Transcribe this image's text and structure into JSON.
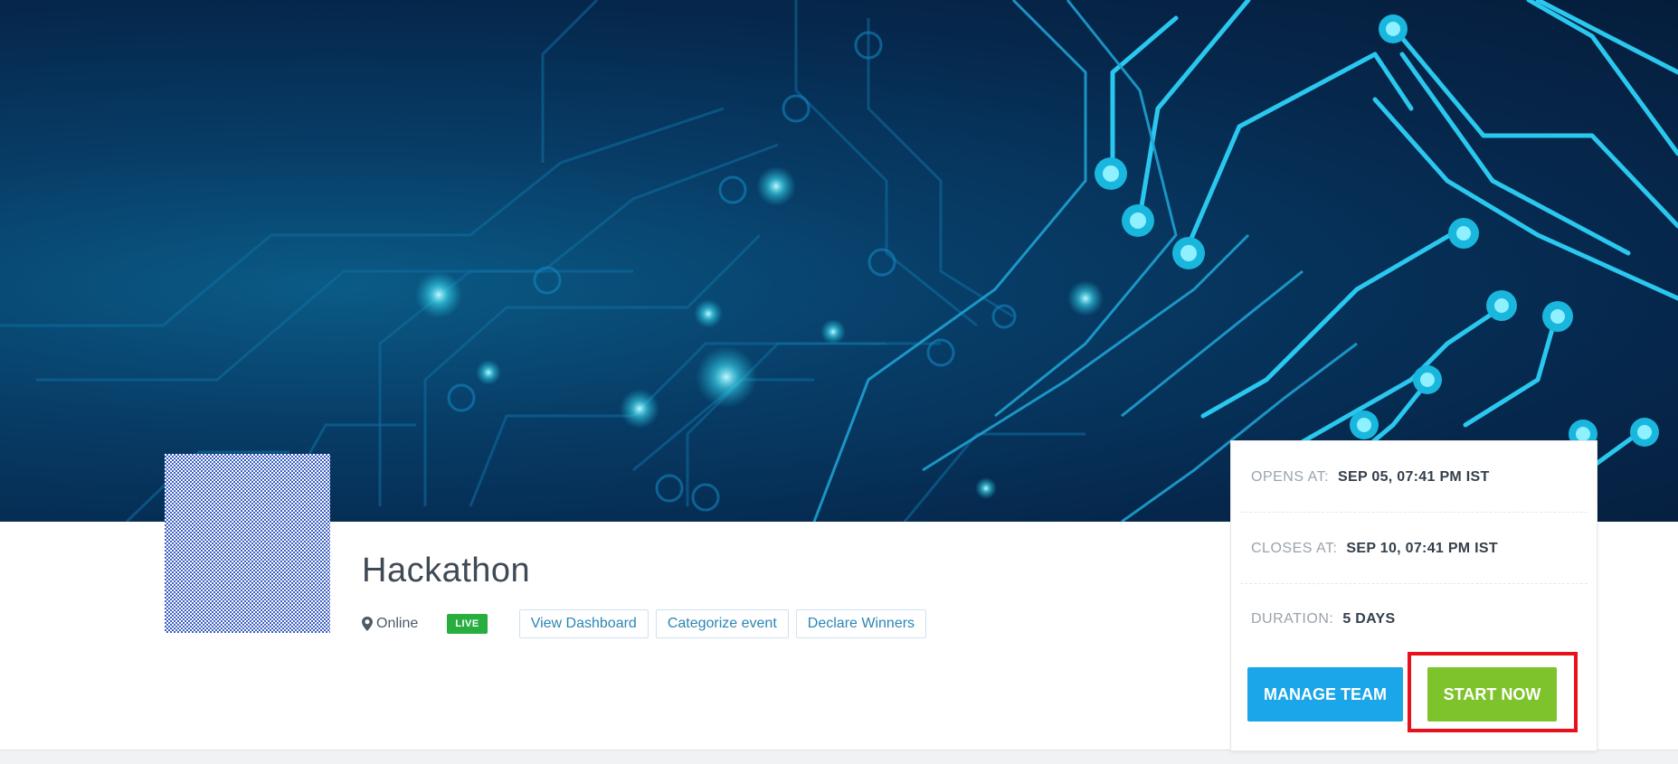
{
  "event": {
    "title": "Hackathon",
    "location": "Online",
    "status_badge": "LIVE"
  },
  "actions": {
    "view_dashboard": "View Dashboard",
    "categorize_event": "Categorize event",
    "declare_winners": "Declare Winners"
  },
  "schedule": {
    "opens_label": "OPENS AT:",
    "opens_value": "SEP 05, 07:41 PM IST",
    "closes_label": "CLOSES AT:",
    "closes_value": "SEP 10, 07:41 PM IST",
    "duration_label": "DURATION:",
    "duration_value": "5 DAYS"
  },
  "buttons": {
    "manage_team": "MANAGE TEAM",
    "start_now": "START NOW"
  },
  "colors": {
    "live_badge": "#27ae3f",
    "manage_team": "#1aa6e8",
    "start_now": "#7dc32b",
    "highlight": "#e8101b",
    "link_text": "#2b86b6"
  },
  "icons": {
    "location": "map-pin-icon"
  }
}
